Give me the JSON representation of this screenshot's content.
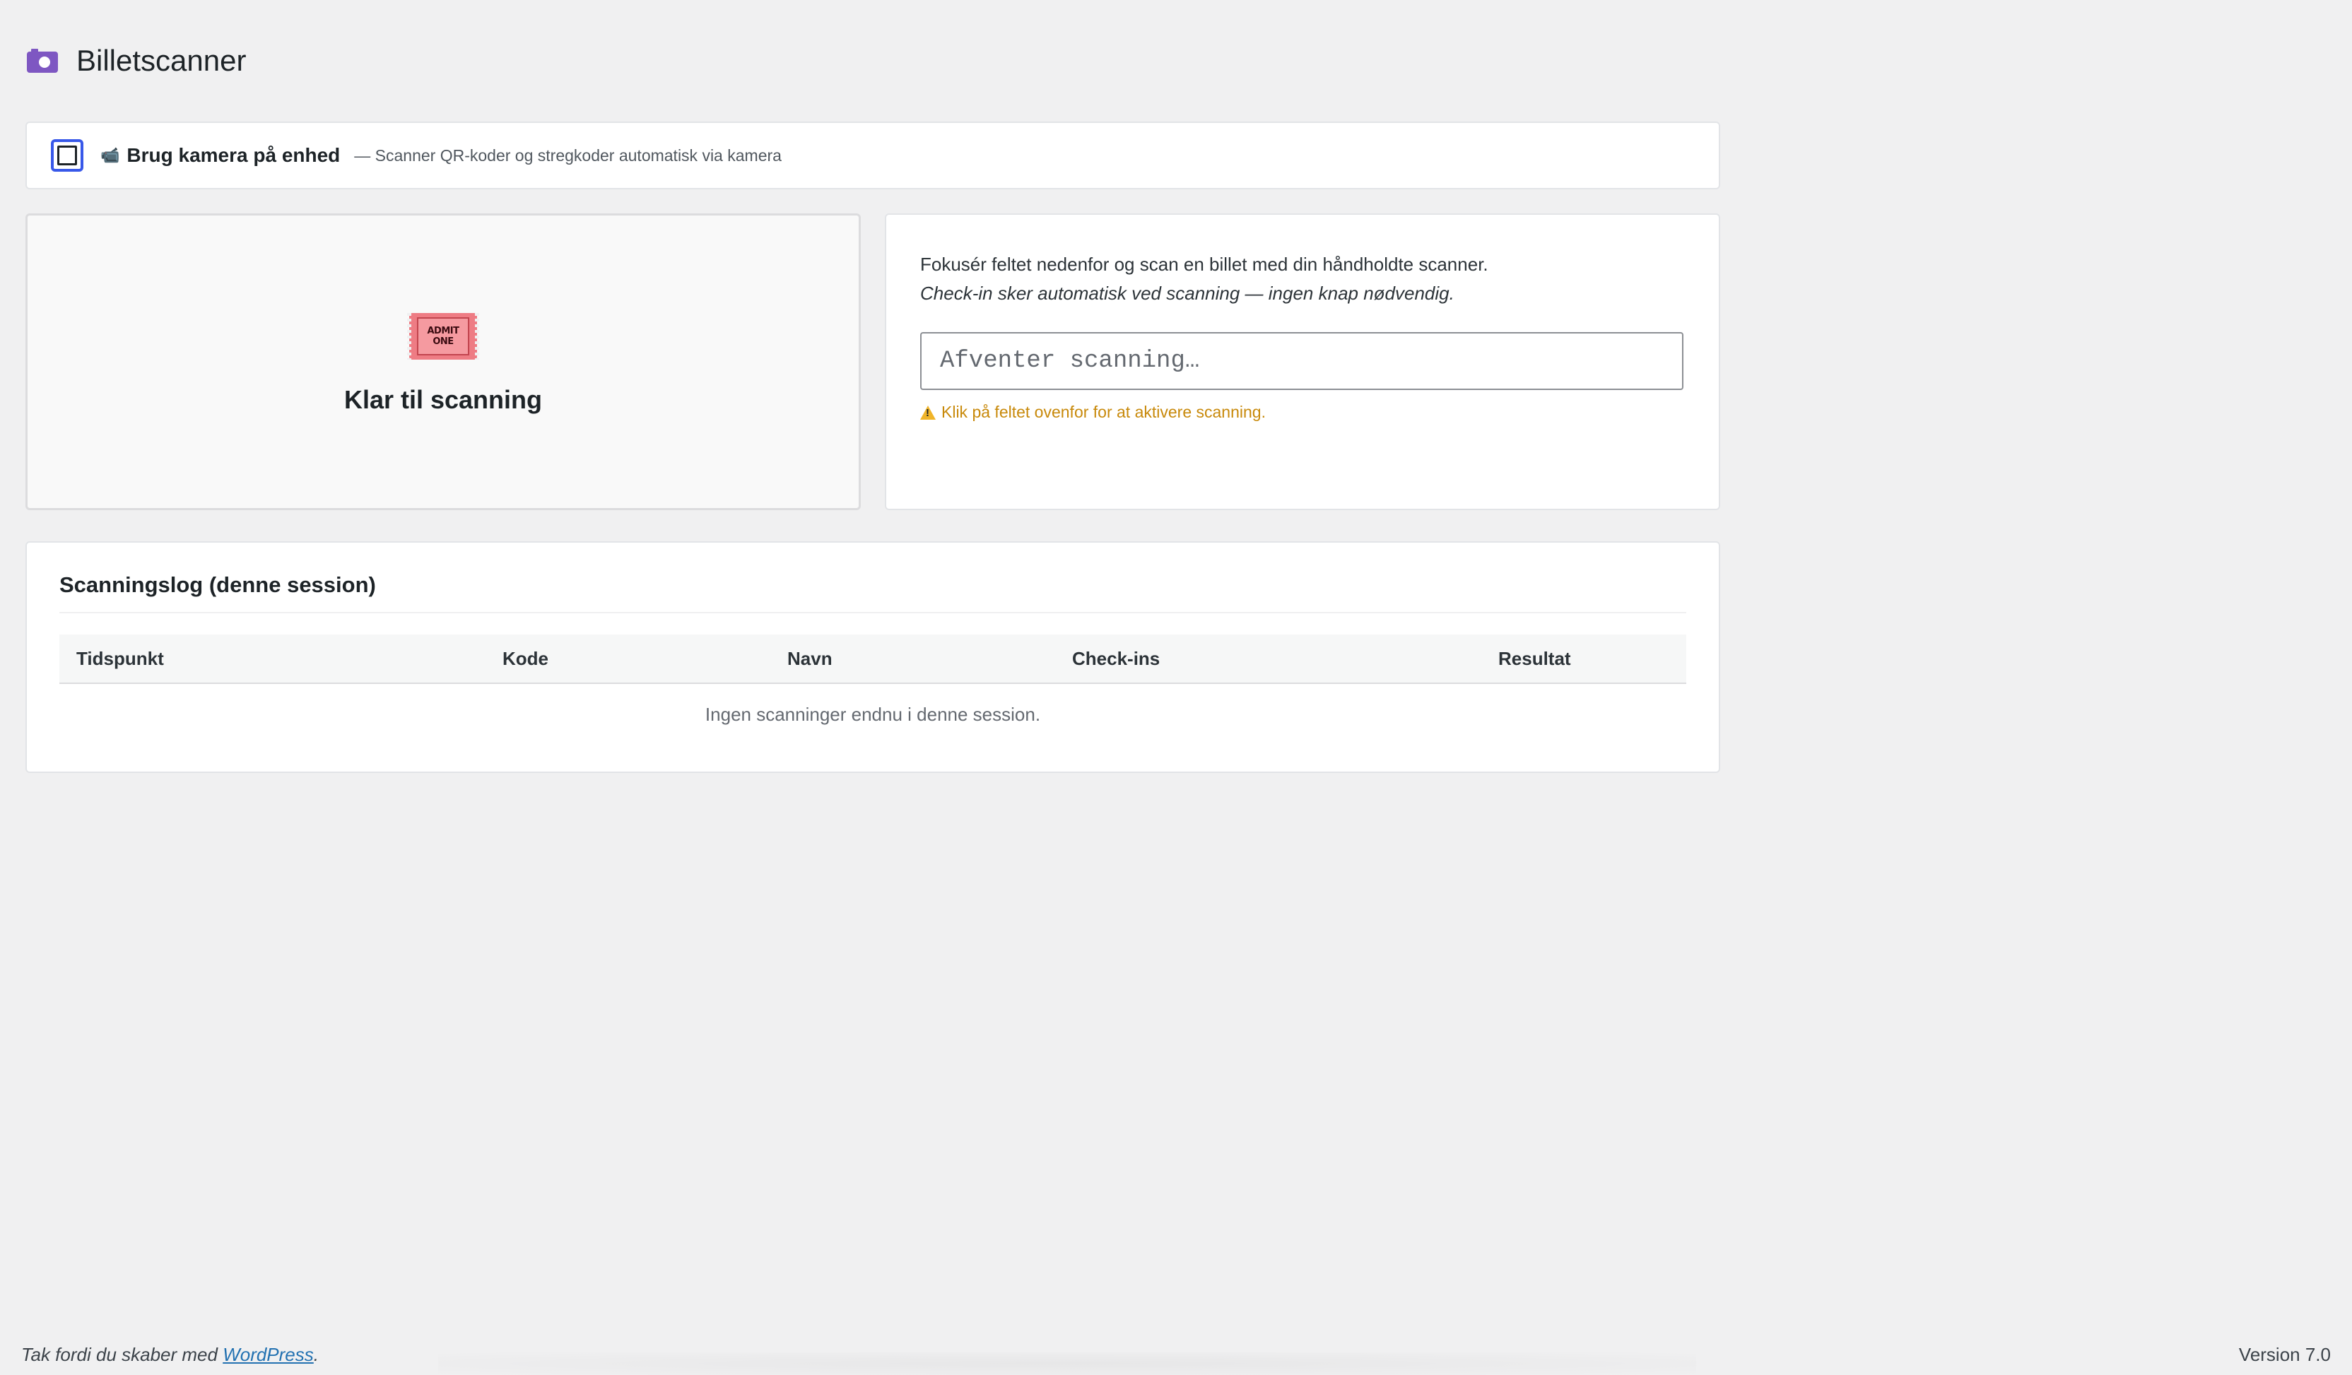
{
  "header": {
    "title": "Billetscanner",
    "icon": "camera-icon"
  },
  "camera_toggle": {
    "checked": false,
    "icon": "video-camera-icon",
    "label": "Brug kamera på enhed",
    "description": "— Scanner QR-koder og stregkoder automatisk via kamera"
  },
  "scan_status": {
    "icon": "admit-one-ticket-icon",
    "ticket_line1": "ADMIT",
    "ticket_line2": "ONE",
    "title": "Klar til scanning"
  },
  "scanner": {
    "instruction": "Fokusér feltet nedenfor og scan en billet med din håndholdte scanner.",
    "instruction_italic": "Check-in sker automatisk ved scanning — ingen knap nødvendig.",
    "input_value": "",
    "input_placeholder": "Afventer scanning…",
    "warning": "Klik på feltet ovenfor for at aktivere scanning."
  },
  "log": {
    "title": "Scanningslog (denne session)",
    "columns": [
      "Tidspunkt",
      "Kode",
      "Navn",
      "Check-ins",
      "Resultat"
    ],
    "rows": [],
    "empty_message": "Ingen scanninger endnu i denne session."
  },
  "footer": {
    "thanks_prefix": "Tak fordi du skaber med ",
    "link": "WordPress",
    "thanks_suffix": ".",
    "version": "Version 7.0"
  },
  "colors": {
    "accent": "#3858e9",
    "icon_purple": "#7e57c2",
    "warning": "#dba617",
    "link": "#2271b1",
    "background": "#f0f0f1"
  }
}
